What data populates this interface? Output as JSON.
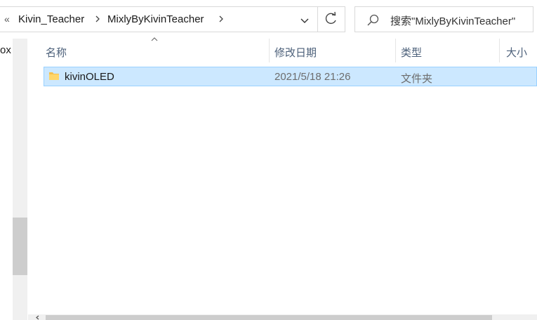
{
  "breadcrumb": {
    "overflow": "«",
    "items": [
      {
        "label": "Kivin_Teacher"
      },
      {
        "label": "MixlyByKivinTeacher"
      }
    ]
  },
  "search": {
    "placeholder": "搜索\"MixlyByKivinTeacher\""
  },
  "nav": {
    "partial_item": "ox"
  },
  "columns": {
    "name": "名称",
    "date": "修改日期",
    "type": "类型",
    "size": "大小"
  },
  "files": [
    {
      "name": "kivinOLED",
      "date": "2021/5/18 21:26",
      "type": "文件夹",
      "size": "",
      "selected": true
    }
  ],
  "colors": {
    "selection_bg": "#cce8ff",
    "selection_border": "#99d1ff",
    "header_text": "#4c607a",
    "folder": "#f5c04f"
  }
}
